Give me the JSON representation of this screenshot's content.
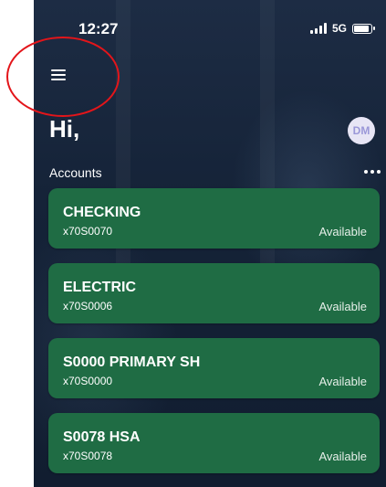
{
  "status_bar": {
    "time": "12:27",
    "network": "5G",
    "icons": [
      "signal-icon",
      "battery-icon"
    ]
  },
  "header": {
    "menu_icon": "hamburger-menu-icon",
    "greeting": "Hi,",
    "avatar_initials": "DM"
  },
  "accounts_section": {
    "title": "Accounts",
    "more_icon": "more-options-icon",
    "items": [
      {
        "name": "CHECKING",
        "number": "x70S0070",
        "status": "Available"
      },
      {
        "name": "ELECTRIC",
        "number": "x70S0006",
        "status": "Available"
      },
      {
        "name": "S0000 PRIMARY SH",
        "number": "x70S0000",
        "status": "Available"
      },
      {
        "name": "S0078 HSA",
        "number": "x70S0078",
        "status": "Available"
      }
    ]
  },
  "colors": {
    "background": "#152338",
    "card": "#1f6c44",
    "avatar_bg": "#e7e5f5",
    "avatar_text": "#9a97d8",
    "annotation": "#e3151a"
  }
}
